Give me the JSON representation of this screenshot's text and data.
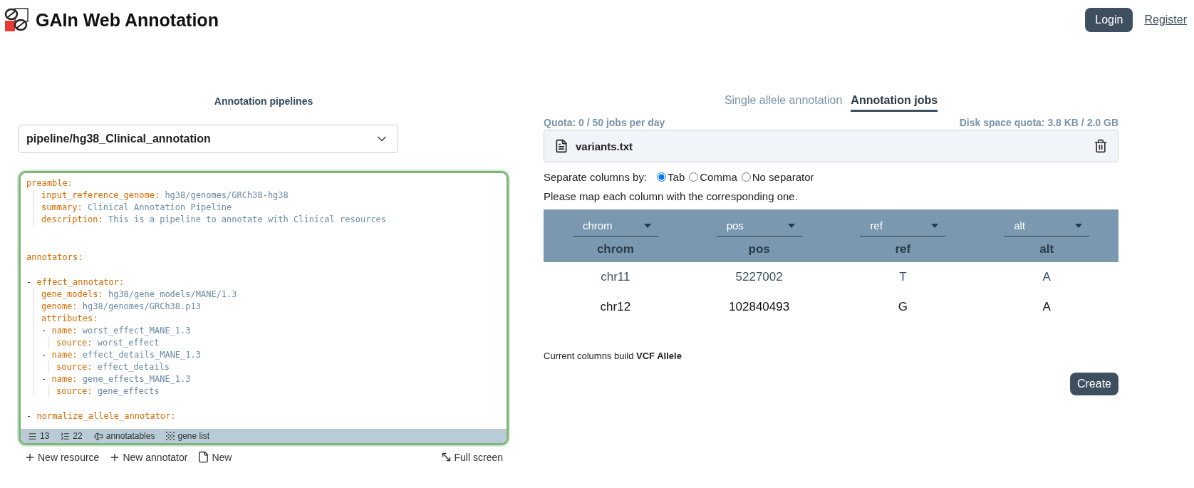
{
  "header": {
    "title": "GAIn Web Annotation",
    "login": "Login",
    "register": "Register"
  },
  "pipelines": {
    "heading": "Annotation pipelines",
    "selected_pipeline": "pipeline/hg38_Clinical_annotation",
    "editor": {
      "entries": [
        {
          "kind": "mapping",
          "key": "preamble:",
          "children": [
            {
              "kind": "pair",
              "key": "input_reference_genome:",
              "value": "hg38/genomes/GRCh38-hg38"
            },
            {
              "kind": "pair",
              "key": "summary:",
              "value": "Clinical Annotation Pipeline"
            },
            {
              "kind": "pair",
              "key": "description:",
              "value": "This is a pipeline to annotate with Clinical resources"
            }
          ]
        },
        {
          "kind": "mapping",
          "key": "annotators:"
        },
        {
          "kind": "list_item",
          "marker": "-",
          "key": "effect_annotator:",
          "children": [
            {
              "kind": "pair",
              "key": "gene_models:",
              "value": "hg38/gene_models/MANE/1.3"
            },
            {
              "kind": "pair",
              "key": "genome:",
              "value": "hg38/genomes/GRCh38.p13"
            },
            {
              "kind": "mapping",
              "key": "attributes:",
              "children": [
                {
                  "kind": "list_item",
                  "marker": "-",
                  "key": "name:",
                  "value": "worst_effect_MANE_1.3",
                  "children": [
                    {
                      "kind": "pair",
                      "key": "source:",
                      "value": "worst_effect"
                    }
                  ]
                },
                {
                  "kind": "list_item",
                  "marker": "-",
                  "key": "name:",
                  "value": "effect_details_MANE_1.3",
                  "children": [
                    {
                      "kind": "pair",
                      "key": "source:",
                      "value": "effect_details"
                    }
                  ]
                },
                {
                  "kind": "list_item",
                  "marker": "-",
                  "key": "name:",
                  "value": "gene_effects_MANE_1.3",
                  "children": [
                    {
                      "kind": "pair",
                      "key": "source:",
                      "value": "gene_effects"
                    }
                  ]
                }
              ]
            }
          ]
        },
        {
          "kind": "list_item",
          "marker": "-",
          "key": "normalize_allele_annotator:"
        }
      ],
      "status_bar": [
        {
          "kind": "lines",
          "label": "13"
        },
        {
          "kind": "indent",
          "label": "22"
        },
        {
          "kind": "annotatables",
          "label": "annotatables"
        },
        {
          "kind": "gene_list",
          "label": "gene list"
        }
      ]
    },
    "actions": [
      {
        "kind": "add",
        "label": "New resource"
      },
      {
        "kind": "add",
        "label": "New annotator"
      },
      {
        "kind": "file",
        "label": "New"
      }
    ],
    "fullscreen": "Full screen"
  },
  "jobs": {
    "tabs": [
      {
        "label": "Single allele annotation",
        "selected": false
      },
      {
        "label": "Annotation jobs",
        "selected": true
      }
    ],
    "quota": "Quota: 0 / 50 jobs per day",
    "disk_quota": "Disk space quota: 3.8 KB / 2.0 GB",
    "file": {
      "name": "variants.txt"
    },
    "separator": {
      "label": "Separate columns by:",
      "options": [
        {
          "label": "Tab",
          "selected": true
        },
        {
          "label": "Comma",
          "selected": false
        },
        {
          "label": "No separator",
          "selected": false
        }
      ]
    },
    "instruction": "Please map each column with the corresponding one.",
    "table": {
      "columns": [
        {
          "mapping": "chrom",
          "label": "chrom"
        },
        {
          "mapping": "pos",
          "label": "pos"
        },
        {
          "mapping": "ref",
          "label": "ref"
        },
        {
          "mapping": "alt",
          "label": "alt"
        }
      ],
      "rows": [
        {
          "highlighted": true,
          "cells": [
            "chr11",
            "5227002",
            "T",
            "A"
          ]
        },
        {
          "highlighted": false,
          "cells": [
            "chr12",
            "102840493",
            "G",
            "A"
          ]
        }
      ]
    },
    "summary": "Current columns build **VCF Allele**",
    "create": "Create"
  }
}
